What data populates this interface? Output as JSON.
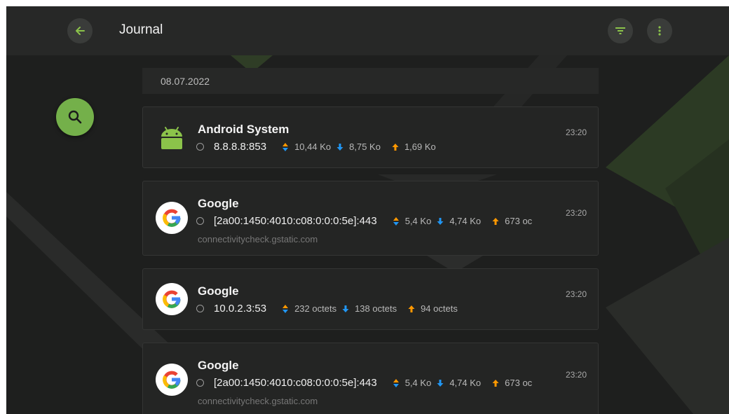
{
  "header": {
    "title": "Journal",
    "back_icon": "arrow-left-icon",
    "filter_icon": "filter-icon",
    "menu_icon": "more-vert-icon"
  },
  "search_fab_icon": "search-icon",
  "date": "08.07.2022",
  "colors": {
    "accent_green": "#74b04a",
    "up_arrow": "#ff9800",
    "down_arrow": "#2196f3",
    "background": "#1e1f1e"
  },
  "entries": [
    {
      "app": "Android System",
      "icon": "android-icon",
      "address": "8.8.8.8:853",
      "total": "10,44 Ko",
      "received": "8,75 Ko",
      "sent": "1,69 Ko",
      "host": "",
      "time": "23:20"
    },
    {
      "app": "Google",
      "icon": "google-icon",
      "address": "[2a00:1450:4010:c08:0:0:0:5e]:443",
      "total": "5,4 Ko",
      "received": "4,74 Ko",
      "sent": "673 oc",
      "host": "connectivitycheck.gstatic.com",
      "time": "23:20"
    },
    {
      "app": "Google",
      "icon": "google-icon",
      "address": "10.0.2.3:53",
      "total": "232 octets",
      "received": "138 octets",
      "sent": "94 octets",
      "host": "",
      "time": "23:20"
    },
    {
      "app": "Google",
      "icon": "google-icon",
      "address": "[2a00:1450:4010:c08:0:0:0:5e]:443",
      "total": "5,4 Ko",
      "received": "4,74 Ko",
      "sent": "673 oc",
      "host": "connectivitycheck.gstatic.com",
      "time": "23:20"
    }
  ]
}
